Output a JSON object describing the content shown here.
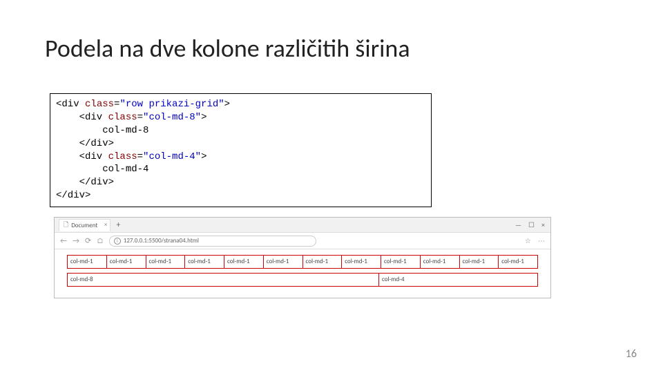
{
  "title": "Podela na dve kolone različitih širina",
  "code": {
    "l1a": "<div ",
    "l1b": "class",
    "l1c": "=",
    "l1d": "\"row prikazi-grid\"",
    "l1e": ">",
    "l2a": "    <div ",
    "l2b": "class",
    "l2c": "=",
    "l2d": "\"col-md-8\"",
    "l2e": ">",
    "l3": "        col-md-8",
    "l4": "    </div>",
    "l5a": "    <div ",
    "l5b": "class",
    "l5c": "=",
    "l5d": "\"col-md-4\"",
    "l5e": ">",
    "l6": "        col-md-4",
    "l7": "    </div>",
    "l8": "</div>"
  },
  "browser": {
    "tab_icon": "🗋",
    "tab_title": "Document",
    "tab_close": "×",
    "plus": "+",
    "win_min": "—",
    "win_max": "☐",
    "win_close": "×",
    "nav_back": "←",
    "nav_fwd": "→",
    "nav_reload": "⟳",
    "nav_home": "⌂",
    "url_info": "i",
    "url": "127.0.0.1:5500/strana04.html",
    "star": "☆",
    "menu": "⋯"
  },
  "grid": {
    "row1": [
      "col-md-1",
      "col-md-1",
      "col-md-1",
      "col-md-1",
      "col-md-1",
      "col-md-1",
      "col-md-1",
      "col-md-1",
      "col-md-1",
      "col-md-1",
      "col-md-1",
      "col-md-1"
    ],
    "row2": {
      "a": "col-md-8",
      "b": "col-md-4"
    }
  },
  "page_number": "16"
}
